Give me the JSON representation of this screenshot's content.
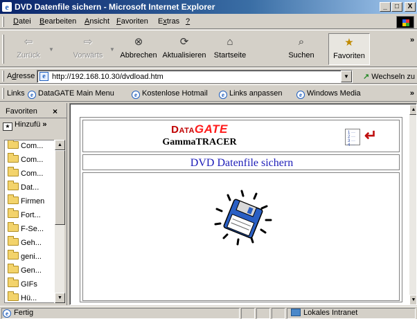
{
  "window": {
    "title": "DVD Datenfile sichern - Microsoft Internet Explorer",
    "buttons": {
      "minimize": "_",
      "maximize": "□",
      "close": "X"
    }
  },
  "menu": {
    "items": [
      {
        "label": "Datei",
        "accel": "D"
      },
      {
        "label": "Bearbeiten",
        "accel": "B"
      },
      {
        "label": "Ansicht",
        "accel": "A"
      },
      {
        "label": "Favoriten",
        "accel": "F"
      },
      {
        "label": "Extras",
        "accel": "x"
      },
      {
        "label": "?",
        "accel": "?"
      }
    ]
  },
  "toolbar": {
    "back": "Zurück",
    "forward": "Vorwärts",
    "stop": "Abbrechen",
    "refresh": "Aktualisieren",
    "home": "Startseite",
    "search": "Suchen",
    "favorites": "Favoriten",
    "more": "»"
  },
  "address": {
    "label": "Adresse",
    "url": "http://192.168.10.30/dvdload.htm",
    "go_label": "Wechseln zu"
  },
  "links": {
    "label": "Links",
    "items": [
      "DataGATE Main Menu",
      "Kostenlose Hotmail",
      "Links anpassen",
      "Windows Media"
    ],
    "more": "»"
  },
  "favorites_pane": {
    "title": "Favoriten",
    "close": "×",
    "add_label": "Hinzufü",
    "more": "»",
    "items": [
      "Com...",
      "Com...",
      "Com...",
      "Dat...",
      "Firmen",
      "Fort...",
      "F-Se...",
      "Geh...",
      "geni...",
      "Gen...",
      "GIFs",
      "Hü..."
    ]
  },
  "page": {
    "logo_dat": "Data",
    "logo_gate": "GATE",
    "product": "GammaTRACER",
    "title": "DVD Datenfile sichern"
  },
  "status": {
    "text": "Fertig",
    "zone": "Lokales Intranet"
  }
}
